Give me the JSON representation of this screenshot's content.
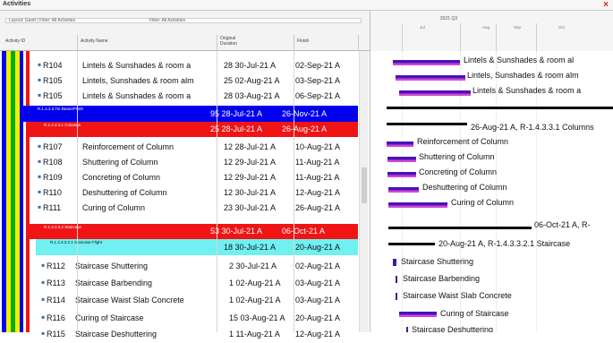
{
  "window": {
    "title": "Activities",
    "close_icon": "close-icon"
  },
  "header": {
    "filter_text": "Layout: Gantt | Filter: All Activities",
    "filter_right": "Filter: All Activities",
    "col_activity_id": "Activity ID",
    "col_activity_name": "Activity Name",
    "col_duration": "Original Duration",
    "col_finish": "Finish"
  },
  "gantt_header": {
    "period": "2021 Q3",
    "sub": [
      "Jul",
      "Aug",
      "Sep",
      "Oct"
    ]
  },
  "rows": [
    {
      "id": "R104",
      "name": "Lintels & Sunshades & room a",
      "dates": "28 30-Jul-21 A",
      "finish": "02-Sep-21 A",
      "bar_label": "Lintels & Sunshades & room al"
    },
    {
      "id": "R105",
      "name": "Lintels, Sunshades & room alm",
      "dates": "25 02-Aug-21 A",
      "finish": "03-Sep-21 A",
      "bar_label": "Lintels, Sunshades & room alm"
    },
    {
      "id": "R105",
      "name": "Lintels & Sunshades & room a",
      "dates": "28 03-Aug-21 A",
      "finish": "06-Sep-21 A",
      "bar_label": "Lintels & Sunshades & room a"
    }
  ],
  "wbs1": {
    "label": "R.1.4.3.3 Tie Beam/Plinth",
    "dates": "95 28-Jul-21 A",
    "finish": "26-Nov-21 A",
    "bar_label": "26-Aug-21 A, R-1.4.3.3.1 Columns"
  },
  "wbs2": {
    "label": "R.1.4.3.3.1 Columns",
    "dates": "25 28-Jul-21 A",
    "finish": "26-Aug-21 A"
  },
  "rows2": [
    {
      "id": "R107",
      "name": "Reinforcement of Column",
      "dates": "12 28-Jul-21 A",
      "finish": "10-Aug-21 A",
      "bar_label": "Reinforcement of Column"
    },
    {
      "id": "R108",
      "name": "Shuttering of Column",
      "dates": "12 29-Jul-21 A",
      "finish": "11-Aug-21 A",
      "bar_label": "Shuttering of Column"
    },
    {
      "id": "R109",
      "name": "Concreting of Column",
      "dates": "12 29-Jul-21 A",
      "finish": "11-Aug-21 A",
      "bar_label": "Concreting of Column"
    },
    {
      "id": "R110",
      "name": "Deshuttering of Column",
      "dates": "12 30-Jul-21 A",
      "finish": "12-Aug-21 A",
      "bar_label": "Deshuttering of Column"
    },
    {
      "id": "R111",
      "name": "Curing of Column",
      "dates": "23 30-Jul-21 A",
      "finish": "26-Aug-21 A",
      "bar_label": "Curing of Column"
    }
  ],
  "wbs3": {
    "label": "R.1.4.3.3.2 Staircase",
    "dates": "53 30-Jul-21 A",
    "finish": "06-Oct-21 A",
    "bar_label": "06-Oct-21 A, R-"
  },
  "wbs4": {
    "label": "R.1.4.3.3.2.1 Staircase Flight",
    "dates": "18 30-Jul-21 A",
    "finish": "20-Aug-21 A",
    "bar_label": "20-Aug-21 A, R-1.4.3.3.2.1 Staircase"
  },
  "rows3": [
    {
      "id": "R112",
      "name": "Staircase Shuttering",
      "dates": "2 30-Jul-21 A",
      "finish": "02-Aug-21 A",
      "bar_label": "Staircase Shuttering"
    },
    {
      "id": "R113",
      "name": "Staircase Barbending",
      "dates": "1 02-Aug-21 A",
      "finish": "03-Aug-21 A",
      "bar_label": "Staircase Barbending"
    },
    {
      "id": "R114",
      "name": "Staircase Waist Slab Concrete",
      "dates": "1 02-Aug-21 A",
      "finish": "03-Aug-21 A",
      "bar_label": "Staircase Waist Slab Concrete"
    },
    {
      "id": "R116",
      "name": "Curing of Staircase",
      "dates": "15 03-Aug-21 A",
      "finish": "20-Aug-21 A",
      "bar_label": "Curing of Staircase"
    },
    {
      "id": "R115",
      "name": "Staircase Deshuttering",
      "dates": "1 11-Aug-21 A",
      "finish": "12-Aug-21 A",
      "bar_label": "Staircase Deshuttering"
    }
  ],
  "colors": {
    "wbs_blue": "#0000ee",
    "wbs_red": "#f01414",
    "wbs_cyan": "#70f0f0",
    "bar_top": "#4a12b8",
    "bar_bottom": "#d048d8"
  }
}
